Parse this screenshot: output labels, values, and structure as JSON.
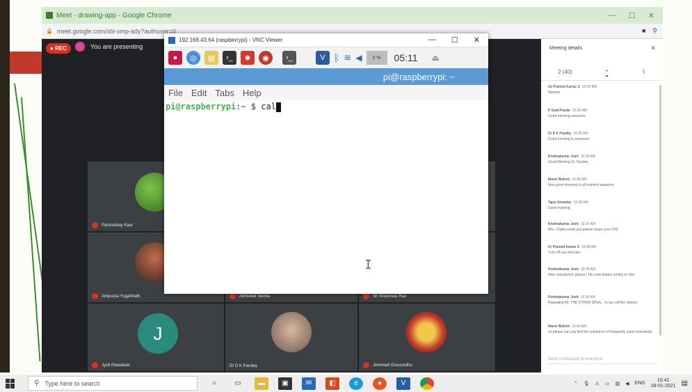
{
  "browser": {
    "tab_title": "Meet - drawing-app - Google Chrome",
    "url": "meet.google.com/xbi-xmp-ady?authuser=0",
    "window_controls": [
      "—",
      "☐",
      "✕"
    ]
  },
  "meet": {
    "rec_label": "REC",
    "presenting_label": "You are presenting",
    "participants": [
      {
        "name": "Parmanbay Kaur"
      },
      {
        "name": "Ampucka Yugahirath"
      },
      {
        "name": "Jyoti Rawatwar"
      },
      {
        "name": "Dr D K Pandey"
      },
      {
        "name": "Jeremiah Dsouvedha"
      },
      {
        "name": "Abhishek Verma"
      },
      {
        "name": "Sri Sreenivas Rao"
      }
    ],
    "avatar_letter": "J"
  },
  "panel": {
    "title": "Meeting details",
    "close": "✕",
    "tabs": [
      "2 (40)",
      "▪",
      "⇪"
    ],
    "messages": [
      {
        "who": "Sri Pramod Kumar S",
        "time": "10:35 AM",
        "text": "Namste"
      },
      {
        "who": "P Sahil Pande",
        "time": "10:35 AM",
        "text": "Good morning everyone"
      },
      {
        "who": "Dr D K Pandey",
        "time": "10:35 AM",
        "text": "Good morning to everyone"
      },
      {
        "who": "Krishnakumar Joshi",
        "time": "10:36 AM",
        "text": "Good Morning Dr. Pandey"
      },
      {
        "who": "Manvi Bishnoi",
        "time": "10:36 AM",
        "text": "Very good morning to all eminent speakers"
      },
      {
        "who": "Tapsi Srivastav",
        "time": "10:36 AM",
        "text": "Good morning"
      },
      {
        "who": "Krishnakumar Joshi",
        "time": "10:37 AM",
        "text": "Mrs. Chaitu could you please share your VNC"
      },
      {
        "who": "Dr Pramod Kumar S",
        "time": "10:38 AM",
        "text": "Turn off you mic/cam"
      },
      {
        "who": "Krishnakumar Joshi",
        "time": "10:39 AM",
        "text": "Now unmute/mic please / Ulu note thanks sonthy to Shri"
      },
      {
        "who": "Krishnakumar Joshi",
        "time": "10:39 AM",
        "text": "Repeating Mr. THE OTHER SPEA... to turn off the Stream"
      },
      {
        "who": "Manvi Bishnoi",
        "time": "10:40 AM",
        "text": "sir please can you find the substance of frequently used commands"
      }
    ],
    "send_placeholder": "Send a message to everyone"
  },
  "vnc": {
    "title": "192.168.43.64 (raspberrypi) - VNC Viewer",
    "window_controls": [
      "—",
      "☐",
      "✕"
    ],
    "cpu_label": "2 %",
    "clock": "05:11",
    "terminal_title": "pi@raspberrypi: ~",
    "menu": [
      "File",
      "Edit",
      "Tabs",
      "Help"
    ],
    "prompt_user": "pi@raspberrypi",
    "prompt_path": ":~",
    "prompt_symbol": " $ ",
    "command": "cal"
  },
  "taskbar": {
    "search_placeholder": "Type here to search",
    "lang": "ENG",
    "time": "10:41",
    "date": "28-01-2021"
  },
  "colors": {
    "meet_bg": "#202124",
    "tile_bg": "#3c4043",
    "terminal_header": "#5b9bd5",
    "prompt_green": "#4caf50",
    "prompt_blue": "#4a78c2",
    "accent_blue": "#1a73e8",
    "rec_red": "#d93025"
  }
}
